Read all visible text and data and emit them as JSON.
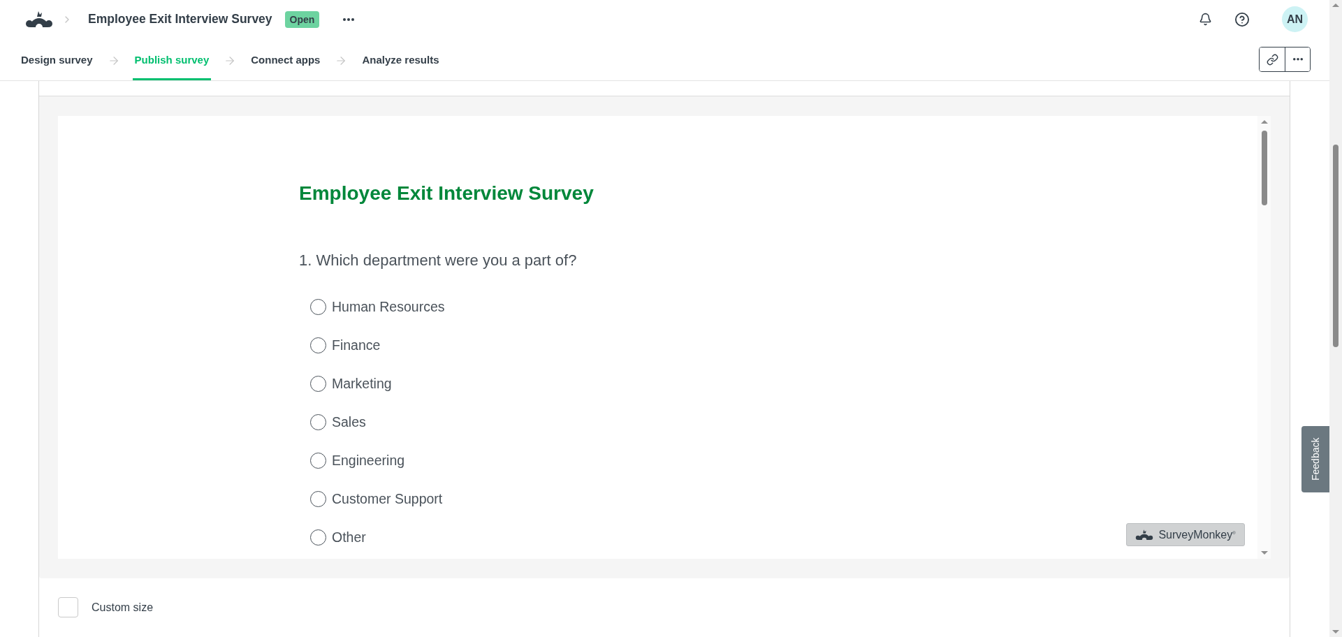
{
  "header": {
    "title": "Employee Exit Interview Survey",
    "status": "Open",
    "avatar_initials": "AN"
  },
  "steps": [
    {
      "label": "Design survey",
      "selected": false
    },
    {
      "label": "Publish survey",
      "selected": true
    },
    {
      "label": "Connect apps",
      "selected": false
    },
    {
      "label": "Analyze results",
      "selected": false
    }
  ],
  "survey": {
    "title": "Employee Exit Interview Survey",
    "questions": [
      {
        "text": "1. Which department were you a part of?",
        "options": [
          {
            "label": "Human Resources",
            "selected": false
          },
          {
            "label": "Finance",
            "selected": false
          },
          {
            "label": "Marketing",
            "selected": false
          },
          {
            "label": "Sales",
            "selected": false
          },
          {
            "label": "Engineering",
            "selected": false
          },
          {
            "label": "Customer Support",
            "selected": false
          },
          {
            "label": "Other",
            "selected": false
          }
        ]
      }
    ],
    "brand": "SurveyMonkey$^{®}$"
  },
  "custom_size": {
    "label": "Custom size",
    "checked": false
  },
  "feedback_tab": "Feedback"
}
